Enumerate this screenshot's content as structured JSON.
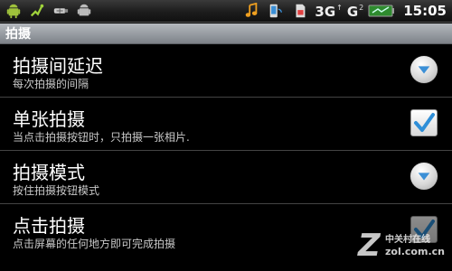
{
  "statusbar": {
    "network_3g": "3G",
    "network_3g_sup": "↑",
    "network_g": "G",
    "network_g_sup": "2",
    "time": "15:05",
    "icons": [
      "android-icon",
      "usb-phone-icon",
      "usb-icon",
      "android-debug-icon",
      "music-note-icon",
      "sync-icon",
      "sd-card-icon",
      "battery-icon"
    ]
  },
  "titlebar": {
    "title": "拍摄"
  },
  "settings": [
    {
      "title": "拍摄间延迟",
      "summary": "每次拍摄的间隔",
      "control": "dropdown"
    },
    {
      "title": "单张拍摄",
      "summary": "当点击拍摄按钮时，只拍摄一张相片.",
      "control": "checkbox",
      "checked": true
    },
    {
      "title": "拍摄模式",
      "summary": "按住拍摄按钮模式",
      "control": "dropdown"
    },
    {
      "title": "点击拍摄",
      "summary": "点击屏幕的任何地方即可完成拍摄",
      "control": "checkbox",
      "checked": true
    }
  ],
  "watermark": {
    "mark": "Z",
    "line1": "中关村在线",
    "line2": "zol.com.cn"
  },
  "colors": {
    "accent_blue": "#3b8fd6",
    "battery_green": "#3fbf3f",
    "titlebar_gray": "#9a9ea4"
  }
}
